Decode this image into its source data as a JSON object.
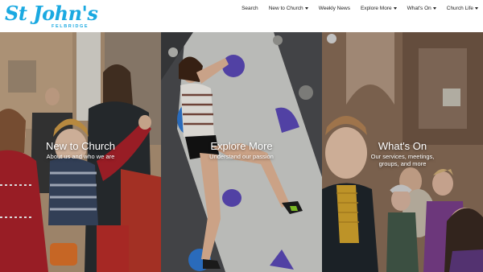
{
  "site": {
    "logo_text": "St John's",
    "logo_sub": "FELBRIDGE"
  },
  "nav": {
    "items": [
      {
        "label": "Search",
        "dropdown": false
      },
      {
        "label": "New to Church",
        "dropdown": true
      },
      {
        "label": "Weekly News",
        "dropdown": false
      },
      {
        "label": "Explore More",
        "dropdown": true
      },
      {
        "label": "What's On",
        "dropdown": true
      },
      {
        "label": "Church Life",
        "dropdown": true
      }
    ]
  },
  "panels": [
    {
      "title": "New to Church",
      "description": "About us and who we are"
    },
    {
      "title": "Explore More",
      "description": "Understand our passion"
    },
    {
      "title": "What's On",
      "description": "Our services, meetings, groups, and more"
    }
  ],
  "colors": {
    "brand": "#1aa9e1",
    "text": "#222222",
    "overlay_text": "#ffffff"
  }
}
